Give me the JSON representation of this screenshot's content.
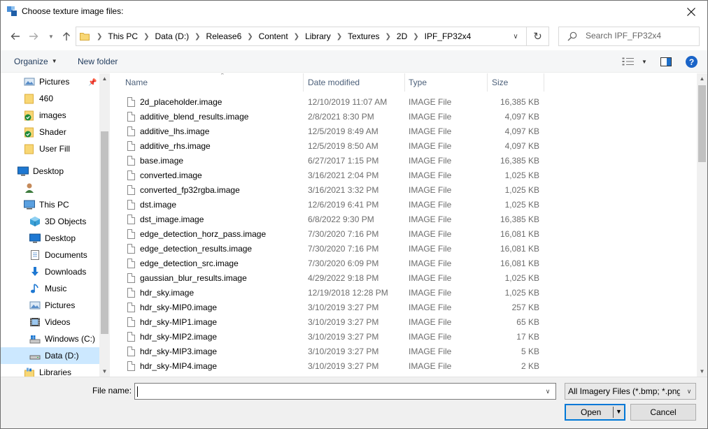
{
  "window": {
    "title": "Choose texture image files:"
  },
  "address": {
    "crumbs": [
      "This PC",
      "Data (D:)",
      "Release6",
      "Content",
      "Library",
      "Textures",
      "2D",
      "IPF_FP32x4"
    ]
  },
  "search": {
    "placeholder": "Search IPF_FP32x4"
  },
  "toolbar": {
    "organize": "Organize",
    "new_folder": "New folder",
    "help": "?"
  },
  "nav": {
    "items": [
      {
        "label": "Pictures",
        "icon": "pictures-icon",
        "pinned": true
      },
      {
        "label": "460",
        "icon": "folder-icon"
      },
      {
        "label": "images",
        "icon": "folder-sync-icon"
      },
      {
        "label": "Shader",
        "icon": "folder-sync-icon"
      },
      {
        "label": "User Fill",
        "icon": "folder-icon"
      },
      {
        "label": "Desktop",
        "icon": "desktop-icon"
      },
      {
        "label": "",
        "icon": "user-icon"
      },
      {
        "label": "This PC",
        "icon": "this-pc-icon"
      },
      {
        "label": "3D Objects",
        "icon": "3d-objects-icon"
      },
      {
        "label": "Desktop",
        "icon": "desktop-icon"
      },
      {
        "label": "Documents",
        "icon": "documents-icon"
      },
      {
        "label": "Downloads",
        "icon": "downloads-icon"
      },
      {
        "label": "Music",
        "icon": "music-icon"
      },
      {
        "label": "Pictures",
        "icon": "pictures-icon"
      },
      {
        "label": "Videos",
        "icon": "videos-icon"
      },
      {
        "label": "Windows (C:)",
        "icon": "drive-c-icon"
      },
      {
        "label": "Data (D:)",
        "icon": "drive-d-icon",
        "selected": true
      },
      {
        "label": "Libraries",
        "icon": "libraries-icon"
      }
    ]
  },
  "columns": {
    "name": "Name",
    "date": "Date modified",
    "type": "Type",
    "size": "Size"
  },
  "files": [
    {
      "name": "2d_placeholder.image",
      "date": "12/10/2019 11:07 AM",
      "type": "IMAGE File",
      "size": "16,385 KB"
    },
    {
      "name": "additive_blend_results.image",
      "date": "2/8/2021 8:30 PM",
      "type": "IMAGE File",
      "size": "4,097 KB"
    },
    {
      "name": "additive_lhs.image",
      "date": "12/5/2019 8:49 AM",
      "type": "IMAGE File",
      "size": "4,097 KB"
    },
    {
      "name": "additive_rhs.image",
      "date": "12/5/2019 8:50 AM",
      "type": "IMAGE File",
      "size": "4,097 KB"
    },
    {
      "name": "base.image",
      "date": "6/27/2017 1:15 PM",
      "type": "IMAGE File",
      "size": "16,385 KB"
    },
    {
      "name": "converted.image",
      "date": "3/16/2021 2:04 PM",
      "type": "IMAGE File",
      "size": "1,025 KB"
    },
    {
      "name": "converted_fp32rgba.image",
      "date": "3/16/2021 3:32 PM",
      "type": "IMAGE File",
      "size": "1,025 KB"
    },
    {
      "name": "dst.image",
      "date": "12/6/2019 6:41 PM",
      "type": "IMAGE File",
      "size": "1,025 KB"
    },
    {
      "name": "dst_image.image",
      "date": "6/8/2022 9:30 PM",
      "type": "IMAGE File",
      "size": "16,385 KB"
    },
    {
      "name": "edge_detection_horz_pass.image",
      "date": "7/30/2020 7:16 PM",
      "type": "IMAGE File",
      "size": "16,081 KB"
    },
    {
      "name": "edge_detection_results.image",
      "date": "7/30/2020 7:16 PM",
      "type": "IMAGE File",
      "size": "16,081 KB"
    },
    {
      "name": "edge_detection_src.image",
      "date": "7/30/2020 6:09 PM",
      "type": "IMAGE File",
      "size": "16,081 KB"
    },
    {
      "name": "gaussian_blur_results.image",
      "date": "4/29/2022 9:18 PM",
      "type": "IMAGE File",
      "size": "1,025 KB"
    },
    {
      "name": "hdr_sky.image",
      "date": "12/19/2018 12:28 PM",
      "type": "IMAGE File",
      "size": "1,025 KB"
    },
    {
      "name": "hdr_sky-MIP0.image",
      "date": "3/10/2019 3:27 PM",
      "type": "IMAGE File",
      "size": "257 KB"
    },
    {
      "name": "hdr_sky-MIP1.image",
      "date": "3/10/2019 3:27 PM",
      "type": "IMAGE File",
      "size": "65 KB"
    },
    {
      "name": "hdr_sky-MIP2.image",
      "date": "3/10/2019 3:27 PM",
      "type": "IMAGE File",
      "size": "17 KB"
    },
    {
      "name": "hdr_sky-MIP3.image",
      "date": "3/10/2019 3:27 PM",
      "type": "IMAGE File",
      "size": "5 KB"
    },
    {
      "name": "hdr_sky-MIP4.image",
      "date": "3/10/2019 3:27 PM",
      "type": "IMAGE File",
      "size": "2 KB"
    }
  ],
  "footer": {
    "file_name_label": "File name:",
    "file_name_value": "",
    "filter": "All Imagery Files (*.bmp; *.png;",
    "open": "Open",
    "cancel": "Cancel"
  },
  "colors": {
    "accent": "#0078d7",
    "selected_bg": "#cce8ff",
    "folder": "#f8d775",
    "link": "#1e395b"
  }
}
